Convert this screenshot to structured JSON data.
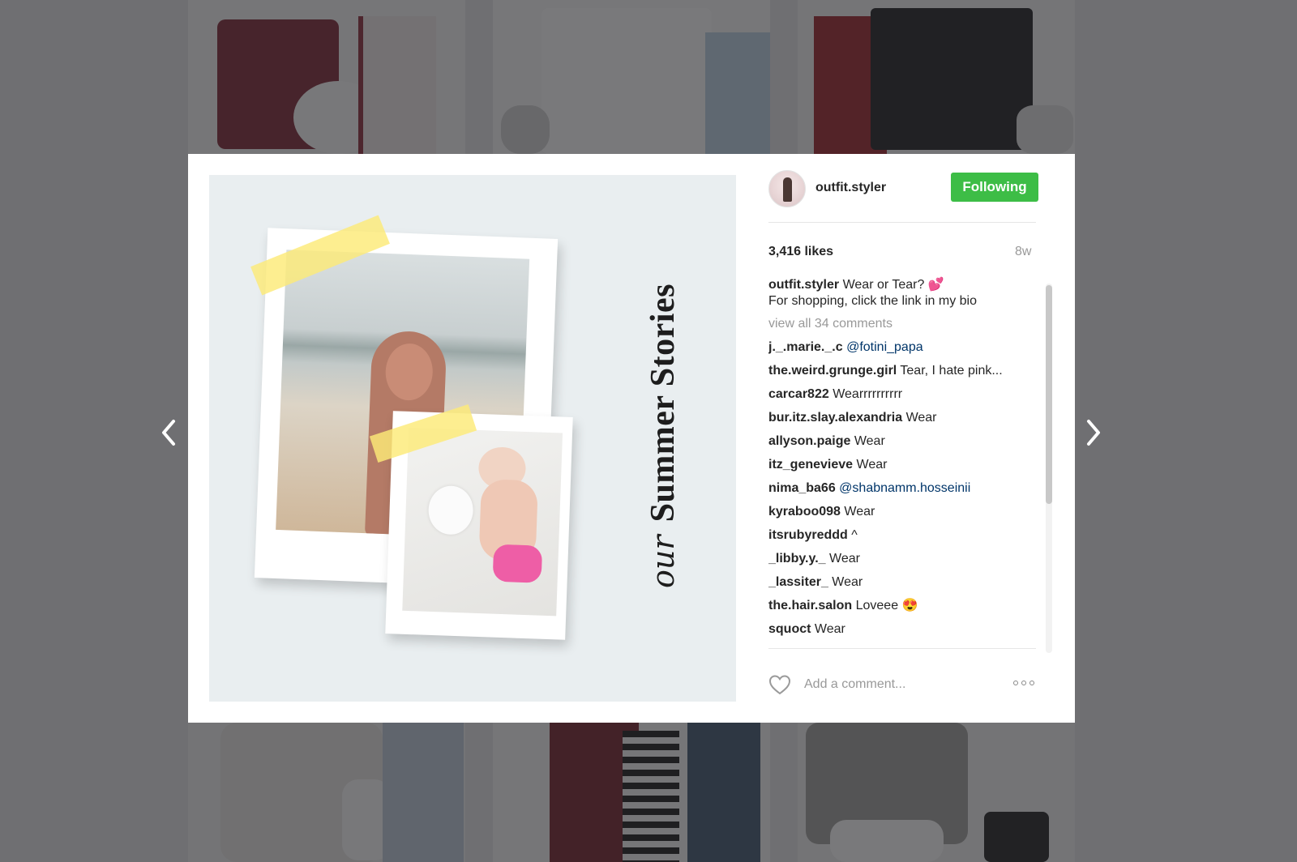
{
  "post": {
    "username": "outfit.styler",
    "follow_label": "Following",
    "likes": "3,416 likes",
    "age": "8w",
    "caption_user": "outfit.styler",
    "caption_text": "Wear or Tear? 💕",
    "caption_line2": "For shopping, click the link in my bio",
    "view_all": "view all 34 comments",
    "image_title_script": "our",
    "image_title": "Summer Stories"
  },
  "comments": [
    {
      "user": "j._.marie._.c",
      "text": "@fotini_papa",
      "mention": true
    },
    {
      "user": "the.weird.grunge.girl",
      "text": "Tear, I hate pink...",
      "mention": false
    },
    {
      "user": "carcar822",
      "text": "Wearrrrrrrrrr",
      "mention": false
    },
    {
      "user": "bur.itz.slay.alexandria",
      "text": "Wear",
      "mention": false
    },
    {
      "user": "allyson.paige",
      "text": "Wear",
      "mention": false
    },
    {
      "user": "itz_genevieve",
      "text": "Wear",
      "mention": false
    },
    {
      "user": "nima_ba66",
      "text": "@shabnamm.hosseinii",
      "mention": true
    },
    {
      "user": "kyraboo098",
      "text": "Wear",
      "mention": false
    },
    {
      "user": "itsrubyreddd",
      "text": "^",
      "mention": false
    },
    {
      "user": "_libby.y._",
      "text": "Wear",
      "mention": false
    },
    {
      "user": "_lassiter_",
      "text": "Wear",
      "mention": false
    },
    {
      "user": "the.hair.salon",
      "text": "Loveee 😍",
      "mention": false
    },
    {
      "user": "squoct",
      "text": "Wear",
      "mention": false
    }
  ],
  "comment_box": {
    "placeholder": "Add a comment..."
  },
  "icons": {
    "prev": "chevron-left-icon",
    "next": "chevron-right-icon",
    "heart": "heart-icon",
    "more": "more-options-icon"
  },
  "colors": {
    "follow_button": "#3dbd46",
    "mention": "#003569",
    "overlay": "#6f6f72"
  }
}
